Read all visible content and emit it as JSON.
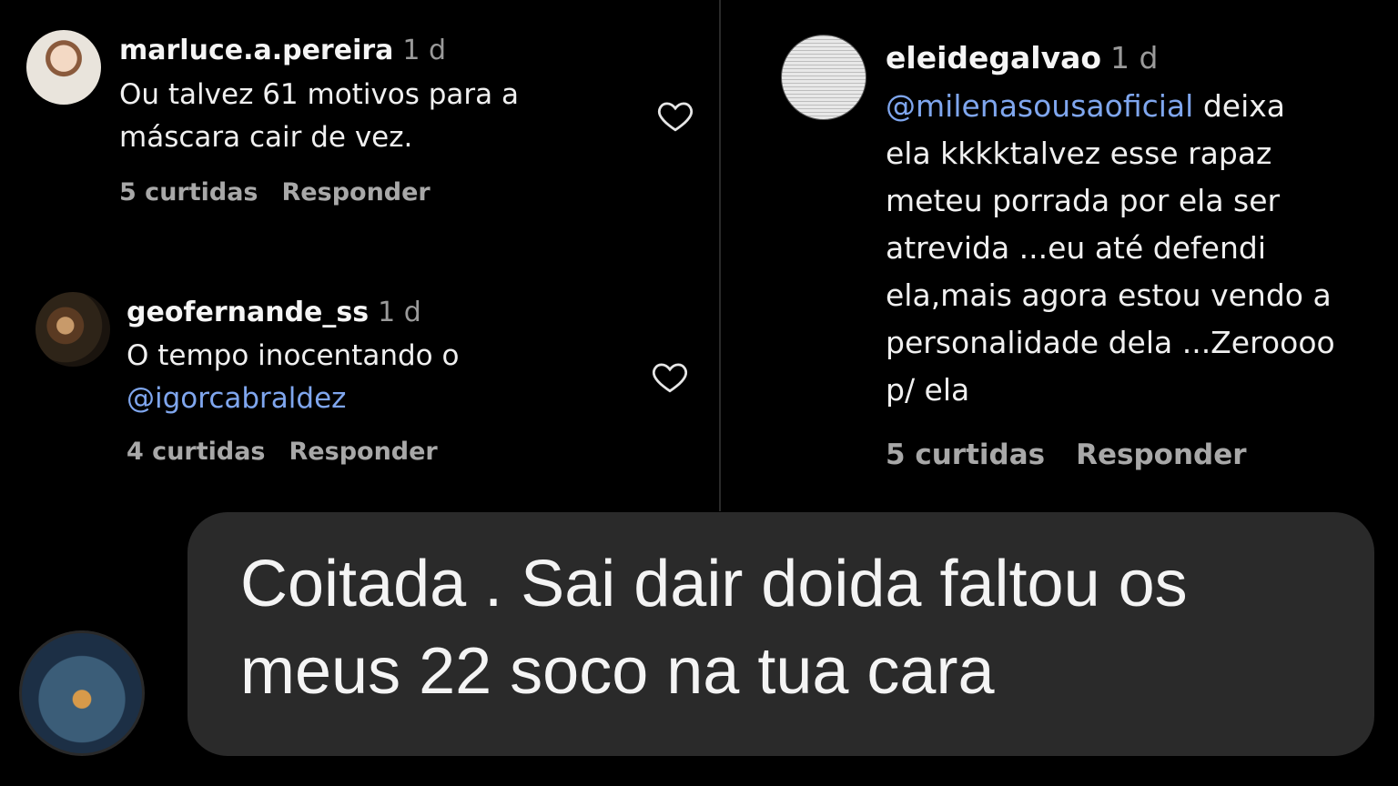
{
  "comments": [
    {
      "username": "marluce.a.pereira",
      "time": "1 d",
      "text_line1": "Ou talvez 61 motivos para a",
      "text_line2": "máscara cair de vez.",
      "likes": "5 curtidas",
      "reply": "Responder",
      "heart_icon": "heart-outline-icon"
    },
    {
      "username": "geofernande_ss",
      "time": "1 d",
      "text_line1": "O tempo inocentando o",
      "mention": "@igorcabraldez",
      "likes": "4 curtidas",
      "reply": "Responder",
      "heart_icon": "heart-outline-icon"
    },
    {
      "username": "eleidegalvao",
      "time": "1 d",
      "mention": "@milenasousaoficial",
      "text_after_mention": " deixa",
      "lines": [
        "ela kkkktalvez esse rapaz",
        "meteu porrada por ela ser",
        "atrevida ...eu até defendi",
        "ela,mais agora estou vendo a",
        "personalidade dela ...Zeroooo",
        "p/ ela"
      ],
      "likes": "5 curtidas",
      "reply": "Responder"
    }
  ],
  "message": {
    "line1": "Coitada . Sai dair doida faltou os",
    "line2": "meus 22 soco na tua cara"
  },
  "colors": {
    "background": "#000000",
    "mention": "#7fa6ee",
    "bubble": "#2a2a2a",
    "muted": "#9a9a9a"
  }
}
